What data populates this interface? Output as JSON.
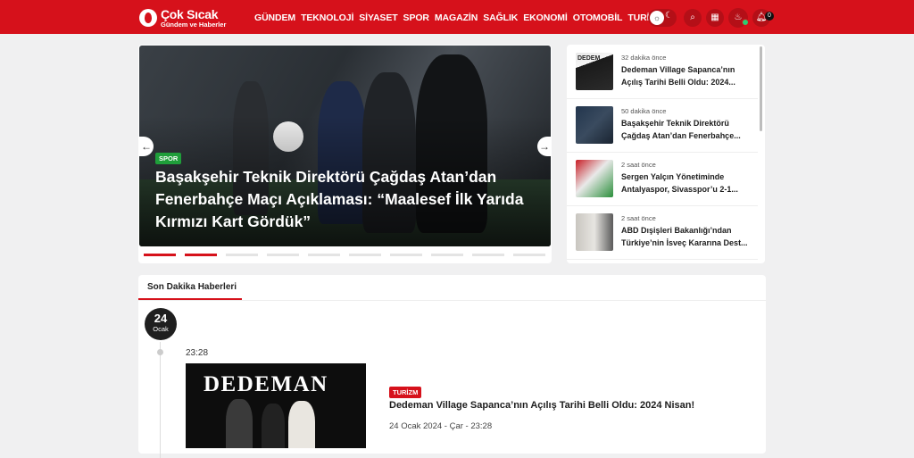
{
  "brand": {
    "name": "Çok Sıcak",
    "tagline": "Gündem ve Haberler"
  },
  "nav": [
    "GÜNDEM",
    "TEKNOLOJİ",
    "SİYASET",
    "SPOR",
    "MAGAZİN",
    "SAĞLIK",
    "EKONOMİ",
    "OTOMOBİL",
    "TURİZM"
  ],
  "header_tools": {
    "notification_count": "0"
  },
  "slider": {
    "category": "SPOR",
    "title": "Başakşehir Teknik Direktörü Çağdaş Atan’dan Fenerbahçe Maçı Açıklaması: “Maalesef İlk Yarıda Kırmızı Kart Gördük”",
    "active_index": 1,
    "dot_count": 10
  },
  "side_list": [
    {
      "time": "32 dakika önce",
      "title": "Dedeman Village Sapanca’nın Açılış Tarihi Belli Oldu: 2024...",
      "thumb_label": "DEDEM"
    },
    {
      "time": "50 dakika önce",
      "title": "Başakşehir Teknik Direktörü Çağdaş Atan’dan Fenerbahçe..."
    },
    {
      "time": "2 saat önce",
      "title": "Sergen Yalçın Yönetiminde Antalyaspor, Sivasspor’u 2-1..."
    },
    {
      "time": "2 saat önce",
      "title": "ABD Dışişleri Bakanlığı’ndan Türkiye’nin İsveç Kararına Dest..."
    }
  ],
  "breaking": {
    "tab": "Son Dakika Haberleri",
    "date_day": "24",
    "date_month": "Ocak",
    "item": {
      "time": "23:28",
      "image_text": "DEDEMAN",
      "category": "TURİZM",
      "title": "Dedeman Village Sapanca’nın Açılış Tarihi Belli Oldu: 2024 Nisan!",
      "date": "24 Ocak 2024 - Çar - 23:28"
    }
  }
}
